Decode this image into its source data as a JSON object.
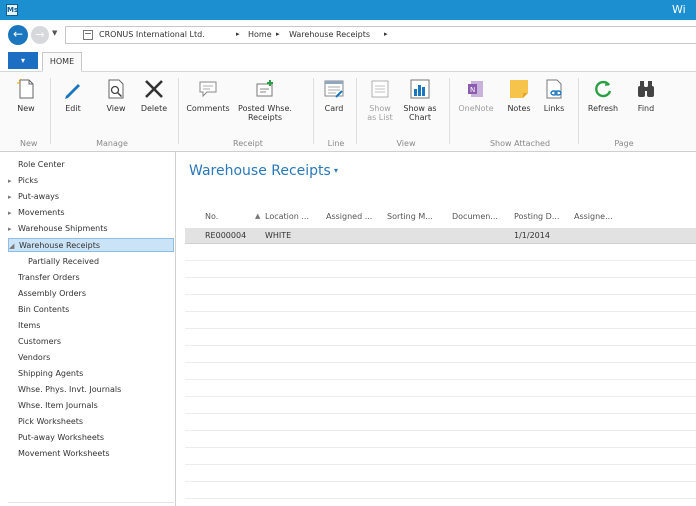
{
  "window": {
    "app_icon": "navision-icon",
    "title": "Wi"
  },
  "address": {
    "crumbs": [
      "CRONUS International Ltd.",
      "Home",
      "Warehouse Receipts"
    ],
    "separator": "▸"
  },
  "tabs": {
    "menu_label": "▾",
    "home_label": "HOME"
  },
  "ribbon": {
    "groups": [
      "New",
      "Manage",
      "Receipt",
      "Line",
      "View",
      "Show Attached",
      "Page"
    ],
    "buttons": {
      "new": "New",
      "edit": "Edit",
      "view": "View",
      "delete": "Delete",
      "comments": "Comments",
      "posted_whse": "Posted Whse.",
      "receipts": "Receipts",
      "card": "Card",
      "show_as_list_1": "Show",
      "show_as_list_2": "as List",
      "show_as_chart_1": "Show as",
      "show_as_chart_2": "Chart",
      "onenote": "OneNote",
      "notes": "Notes",
      "links": "Links",
      "refresh": "Refresh",
      "find": "Find"
    }
  },
  "sidebar": {
    "items": [
      {
        "label": "Role Center",
        "arrow": ""
      },
      {
        "label": "Picks",
        "arrow": "▸"
      },
      {
        "label": "Put-aways",
        "arrow": "▸"
      },
      {
        "label": "Movements",
        "arrow": "▸"
      },
      {
        "label": "Warehouse Shipments",
        "arrow": "▸"
      },
      {
        "label": "Warehouse Receipts",
        "arrow": "◢"
      },
      {
        "label": "Partially Received",
        "arrow": ""
      },
      {
        "label": "Transfer Orders",
        "arrow": ""
      },
      {
        "label": "Assembly Orders",
        "arrow": ""
      },
      {
        "label": "Bin Contents",
        "arrow": ""
      },
      {
        "label": "Items",
        "arrow": ""
      },
      {
        "label": "Customers",
        "arrow": ""
      },
      {
        "label": "Vendors",
        "arrow": ""
      },
      {
        "label": "Shipping Agents",
        "arrow": ""
      },
      {
        "label": "Whse. Phys. Invt. Journals",
        "arrow": ""
      },
      {
        "label": "Whse. Item Journals",
        "arrow": ""
      },
      {
        "label": "Pick Worksheets",
        "arrow": ""
      },
      {
        "label": "Put-away Worksheets",
        "arrow": ""
      },
      {
        "label": "Movement Worksheets",
        "arrow": ""
      }
    ]
  },
  "main": {
    "title": "Warehouse Receipts",
    "title_caret": "▾",
    "sort_indicator": "▲",
    "columns": [
      "No.",
      "Location ...",
      "Assigned ...",
      "Sorting M...",
      "Documen...",
      "Posting D...",
      "Assigne..."
    ],
    "rows": [
      [
        "RE000004",
        "WHITE",
        "",
        "",
        "",
        "1/1/2014",
        ""
      ]
    ]
  },
  "colors": {
    "titlebar": "#1b8fd0",
    "accent": "#1a76be",
    "page_title": "#2a78b8",
    "selected_nav": "#cbe3f7",
    "selected_row": "#e2e2e2"
  }
}
